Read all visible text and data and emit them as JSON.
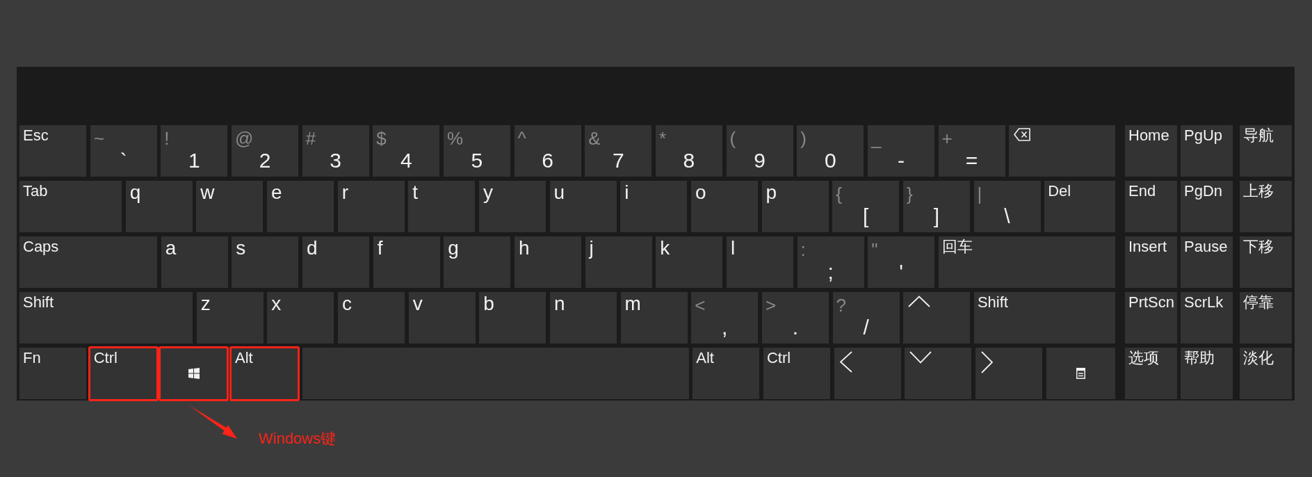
{
  "keyboard": {
    "rows": [
      {
        "keys": [
          {
            "kind": "word",
            "label": "Esc"
          },
          {
            "kind": "symbol",
            "shift": "~",
            "main": "`"
          },
          {
            "kind": "symbol",
            "shift": "!",
            "main": "1"
          },
          {
            "kind": "symbol",
            "shift": "@",
            "main": "2"
          },
          {
            "kind": "symbol",
            "shift": "#",
            "main": "3"
          },
          {
            "kind": "symbol",
            "shift": "$",
            "main": "4"
          },
          {
            "kind": "symbol",
            "shift": "%",
            "main": "5"
          },
          {
            "kind": "symbol",
            "shift": "^",
            "main": "6"
          },
          {
            "kind": "symbol",
            "shift": "&",
            "main": "7"
          },
          {
            "kind": "symbol",
            "shift": "*",
            "main": "8"
          },
          {
            "kind": "symbol",
            "shift": "(",
            "main": "9"
          },
          {
            "kind": "symbol",
            "shift": ")",
            "main": "0"
          },
          {
            "kind": "symbol",
            "shift": "_",
            "main": "-"
          },
          {
            "kind": "symbol",
            "shift": "+",
            "main": "="
          },
          {
            "kind": "backspace"
          }
        ]
      },
      {
        "keys": [
          {
            "kind": "word",
            "label": "Tab"
          },
          {
            "kind": "letter",
            "label": "q"
          },
          {
            "kind": "letter",
            "label": "w"
          },
          {
            "kind": "letter",
            "label": "e"
          },
          {
            "kind": "letter",
            "label": "r"
          },
          {
            "kind": "letter",
            "label": "t"
          },
          {
            "kind": "letter",
            "label": "y"
          },
          {
            "kind": "letter",
            "label": "u"
          },
          {
            "kind": "letter",
            "label": "i"
          },
          {
            "kind": "letter",
            "label": "o"
          },
          {
            "kind": "letter",
            "label": "p"
          },
          {
            "kind": "symbol",
            "shift": "{",
            "main": "["
          },
          {
            "kind": "symbol",
            "shift": "}",
            "main": "]"
          },
          {
            "kind": "symbol",
            "shift": "|",
            "main": "\\"
          },
          {
            "kind": "word",
            "label": "Del"
          }
        ]
      },
      {
        "keys": [
          {
            "kind": "word",
            "label": "Caps"
          },
          {
            "kind": "letter",
            "label": "a"
          },
          {
            "kind": "letter",
            "label": "s"
          },
          {
            "kind": "letter",
            "label": "d"
          },
          {
            "kind": "letter",
            "label": "f"
          },
          {
            "kind": "letter",
            "label": "g"
          },
          {
            "kind": "letter",
            "label": "h"
          },
          {
            "kind": "letter",
            "label": "j"
          },
          {
            "kind": "letter",
            "label": "k"
          },
          {
            "kind": "letter",
            "label": "l"
          },
          {
            "kind": "symbol",
            "shift": ":",
            "main": ";"
          },
          {
            "kind": "symbol",
            "shift": "\"",
            "main": "'"
          },
          {
            "kind": "word",
            "label": "回车"
          }
        ]
      },
      {
        "keys": [
          {
            "kind": "word",
            "label": "Shift"
          },
          {
            "kind": "letter",
            "label": "z"
          },
          {
            "kind": "letter",
            "label": "x"
          },
          {
            "kind": "letter",
            "label": "c"
          },
          {
            "kind": "letter",
            "label": "v"
          },
          {
            "kind": "letter",
            "label": "b"
          },
          {
            "kind": "letter",
            "label": "n"
          },
          {
            "kind": "letter",
            "label": "m"
          },
          {
            "kind": "symbol",
            "shift": "<",
            "main": ","
          },
          {
            "kind": "symbol",
            "shift": ">",
            "main": "."
          },
          {
            "kind": "symbol",
            "shift": "?",
            "main": "/"
          },
          {
            "kind": "up"
          },
          {
            "kind": "word",
            "label": "Shift"
          }
        ]
      },
      {
        "keys": [
          {
            "kind": "word",
            "label": "Fn",
            "highlighted": false
          },
          {
            "kind": "word",
            "label": "Ctrl",
            "highlighted": true
          },
          {
            "kind": "windows",
            "highlighted": true
          },
          {
            "kind": "word",
            "label": "Alt",
            "highlighted": true
          },
          {
            "kind": "space",
            "highlighted": false
          },
          {
            "kind": "word",
            "label": "Alt",
            "highlighted": false
          },
          {
            "kind": "word",
            "label": "Ctrl",
            "highlighted": false
          },
          {
            "kind": "left",
            "highlighted": false
          },
          {
            "kind": "down",
            "highlighted": false
          },
          {
            "kind": "right",
            "highlighted": false
          },
          {
            "kind": "menu",
            "highlighted": false
          }
        ]
      }
    ],
    "nav_rows": [
      {
        "keys": [
          {
            "label": "Home"
          },
          {
            "label": "PgUp"
          },
          {
            "label": "导航"
          }
        ]
      },
      {
        "keys": [
          {
            "label": "End"
          },
          {
            "label": "PgDn"
          },
          {
            "label": "上移"
          }
        ]
      },
      {
        "keys": [
          {
            "label": "Insert"
          },
          {
            "label": "Pause"
          },
          {
            "label": "下移"
          }
        ]
      },
      {
        "keys": [
          {
            "label": "PrtScn"
          },
          {
            "label": "ScrLk"
          },
          {
            "label": "停靠"
          }
        ]
      },
      {
        "keys": [
          {
            "label": "选项"
          },
          {
            "label": "帮助"
          },
          {
            "label": "淡化"
          }
        ]
      }
    ]
  },
  "annotation": {
    "text": "Windows键"
  }
}
